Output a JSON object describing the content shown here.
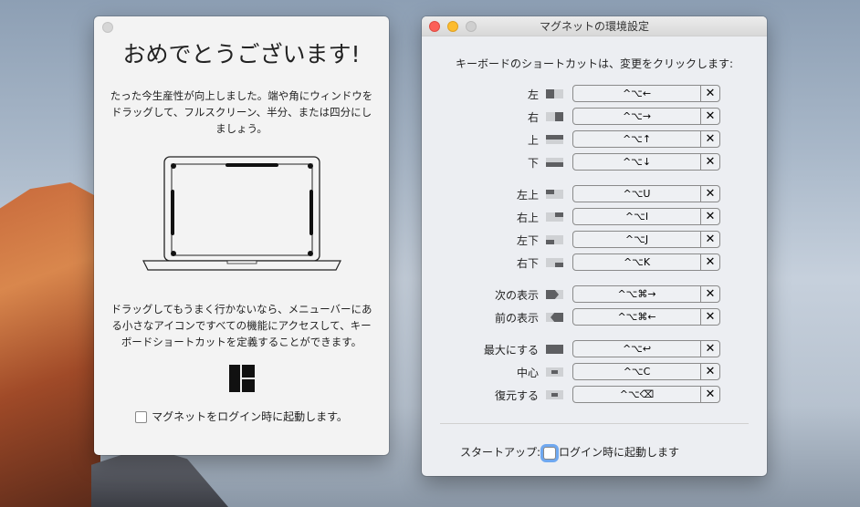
{
  "welcome": {
    "title": "おめでとうございます!",
    "text1": "たった今生産性が向上しました。端や角にウィンドウをドラッグして、フルスクリーン、半分、または四分にしましょう。",
    "text2": "ドラッグしてもうまく行かないなら、メニューバーにある小さなアイコンですべての機能にアクセスして、キーボードショートカットを定義することができます。",
    "login_checkbox": "マグネットをログイン時に起動します。"
  },
  "prefs": {
    "title": "マグネットの環境設定",
    "instruction": "キーボードのショートカットは、変更をクリックします:",
    "shortcuts": [
      {
        "label": "左",
        "keys": "^⌥←",
        "icon": "left"
      },
      {
        "label": "右",
        "keys": "^⌥→",
        "icon": "right"
      },
      {
        "label": "上",
        "keys": "^⌥↑",
        "icon": "top"
      },
      {
        "label": "下",
        "keys": "^⌥↓",
        "icon": "bottom"
      },
      {
        "label": "左上",
        "keys": "^⌥U",
        "icon": "tl"
      },
      {
        "label": "右上",
        "keys": "^⌥I",
        "icon": "tr"
      },
      {
        "label": "左下",
        "keys": "^⌥J",
        "icon": "bl"
      },
      {
        "label": "右下",
        "keys": "^⌥K",
        "icon": "br"
      },
      {
        "label": "次の表示",
        "keys": "^⌥⌘→",
        "icon": "next"
      },
      {
        "label": "前の表示",
        "keys": "^⌥⌘←",
        "icon": "prev"
      },
      {
        "label": "最大にする",
        "keys": "^⌥↩",
        "icon": "max"
      },
      {
        "label": "中心",
        "keys": "^⌥C",
        "icon": "center"
      },
      {
        "label": "復元する",
        "keys": "^⌥⌫",
        "icon": "restore"
      }
    ],
    "clear_label": "✕",
    "startup_label": "スタートアップ:",
    "startup_checkbox": "ログイン時に起動します"
  }
}
